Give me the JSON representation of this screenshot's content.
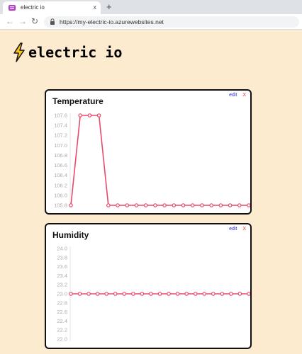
{
  "browser": {
    "tab_title": "electric io",
    "tab_close": "x",
    "new_tab": "+",
    "url": "https://my-electric-io.azurewebsites.net"
  },
  "app": {
    "title": "electric io"
  },
  "cards": [
    {
      "title": "Temperature",
      "edit_label": "edit",
      "delete_label": "X",
      "chart_data": {
        "type": "line",
        "title": "Temperature",
        "ylim": [
          105.8,
          107.6
        ],
        "yticks": [
          "107.6",
          "107.4",
          "107.2",
          "107.0",
          "106.8",
          "106.6",
          "106.4",
          "106.2",
          "106.0",
          "105.8"
        ],
        "series": [
          {
            "values": [
              105.8,
              107.6,
              107.6,
              107.6,
              105.8,
              105.8,
              105.8,
              105.8,
              105.8,
              105.8,
              105.8,
              105.8,
              105.8,
              105.8,
              105.8,
              105.8,
              105.8,
              105.8,
              105.8,
              105.8
            ]
          }
        ],
        "color": "#e84a6a",
        "grid": false
      }
    },
    {
      "title": "Humidity",
      "edit_label": "edit",
      "delete_label": "X",
      "chart_data": {
        "type": "line",
        "title": "Humidity",
        "ylim": [
          22.0,
          24.0
        ],
        "yticks": [
          "24.0",
          "23.8",
          "23.6",
          "23.4",
          "23.2",
          "23.0",
          "22.8",
          "22.6",
          "22.4",
          "22.2",
          "22.0"
        ],
        "series": [
          {
            "values": [
              23.0,
              23.0,
              23.0,
              23.0,
              23.0,
              23.0,
              23.0,
              23.0,
              23.0,
              23.0,
              23.0,
              23.0,
              23.0,
              23.0,
              23.0,
              23.0,
              23.0,
              23.0,
              23.0,
              23.0,
              23.0
            ]
          }
        ],
        "color": "#e84a6a",
        "grid": false
      }
    }
  ]
}
